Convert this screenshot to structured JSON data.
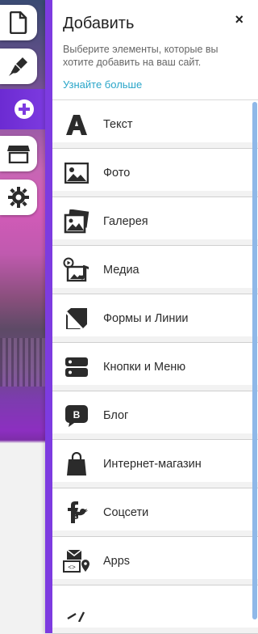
{
  "rail": {
    "items": [
      {
        "name": "pages",
        "icon": "page-icon"
      },
      {
        "name": "design",
        "icon": "paintbrush-icon"
      },
      {
        "name": "add",
        "icon": "plus-circle-icon",
        "active": true
      },
      {
        "name": "app-market",
        "icon": "store-icon"
      },
      {
        "name": "settings",
        "icon": "gear-icon"
      }
    ]
  },
  "panel": {
    "title": "Добавить",
    "subtitle": "Выберите элементы, которые вы хотите добавить на ваш сайт.",
    "learn_more": "Узнайте больше",
    "close_label": "×",
    "items": [
      {
        "label": "Текст",
        "icon": "text-icon"
      },
      {
        "label": "Фото",
        "icon": "photo-icon"
      },
      {
        "label": "Галерея",
        "icon": "gallery-icon"
      },
      {
        "label": "Медиа",
        "icon": "media-icon"
      },
      {
        "label": "Формы и Линии",
        "icon": "shapes-icon"
      },
      {
        "label": "Кнопки и Меню",
        "icon": "buttons-menu-icon"
      },
      {
        "label": "Блог",
        "icon": "blog-icon"
      },
      {
        "label": "Интернет-магазин",
        "icon": "shopping-bag-icon"
      },
      {
        "label": "Соцсети",
        "icon": "social-icon"
      },
      {
        "label": "Apps",
        "icon": "apps-icon"
      },
      {
        "label": "",
        "icon": "more-icon"
      }
    ]
  },
  "colors": {
    "accent": "#7d3be0",
    "link": "#2aa6c9",
    "scrollbar": "#8fb8e8"
  }
}
